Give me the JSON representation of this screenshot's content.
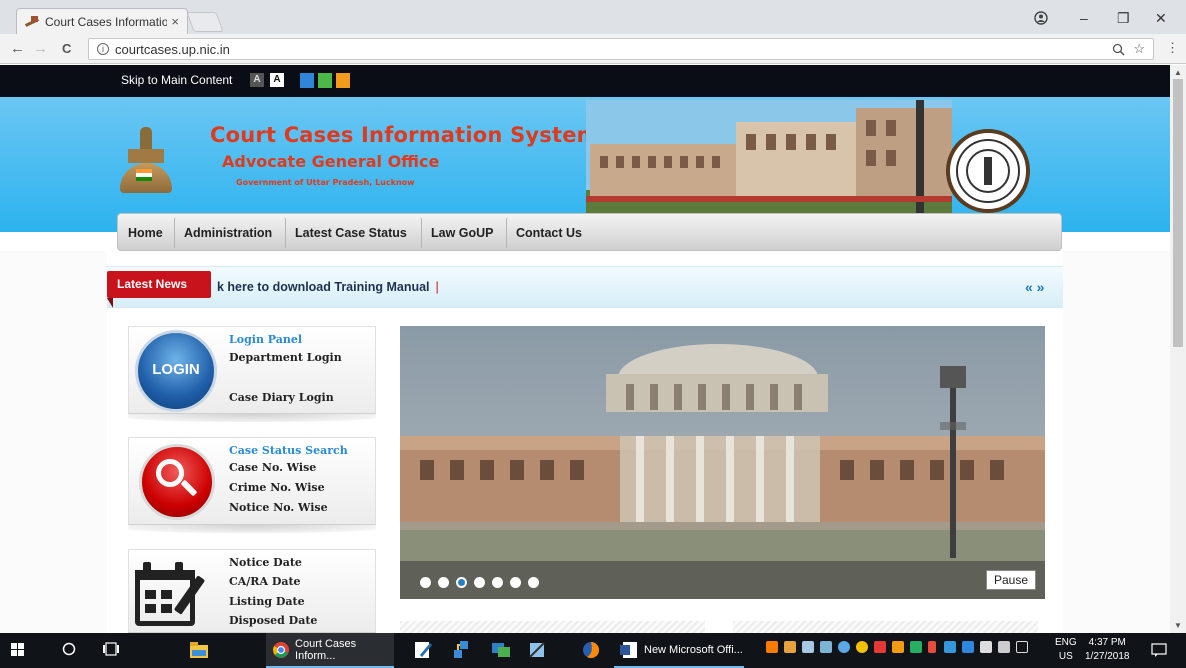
{
  "browser": {
    "tab_title": "Court Cases Information",
    "tab_close": "×",
    "url": "courtcases.up.nic.in",
    "info_glyph": "i",
    "window_controls": {
      "minimize": "–",
      "restore": "❐",
      "close": "✕"
    },
    "nav": {
      "back": "←",
      "forward": "→",
      "reload": "C"
    }
  },
  "accessibility": {
    "skip_link": "Skip to Main Content",
    "font_btn_1": "A",
    "font_btn_2": "A",
    "themes": [
      "#2f86d6",
      "#4cb848",
      "#f29a1c"
    ]
  },
  "header": {
    "title": "Court Cases Information System",
    "subtitle": "Advocate General Office",
    "gov_line": "Government of Uttar Pradesh, Lucknow"
  },
  "menu": {
    "items": [
      "Home",
      "Administration",
      "Latest Case Status",
      "Law GoUP",
      "Contact Us"
    ]
  },
  "news": {
    "label": "Latest News",
    "text": "k here to download Training Manual",
    "separator": "|",
    "nav": "« »"
  },
  "panels": {
    "login": {
      "icon_text": "LOGIN",
      "title": "Login Panel",
      "links": [
        "Department Login",
        "Case Diary Login"
      ]
    },
    "search": {
      "title": "Case Status Search",
      "links": [
        "Case No. Wise",
        "Crime No. Wise",
        "Notice No. Wise"
      ]
    },
    "dates": {
      "links": [
        "Notice Date",
        "CA/RA Date",
        "Listing Date",
        "Disposed Date"
      ]
    }
  },
  "slider": {
    "pause_label": "Pause",
    "dot_count": 7,
    "active_dot": 3
  },
  "taskbar": {
    "apps": [
      "Court Cases Inform...",
      "New Microsoft Offi..."
    ],
    "lang": "ENG",
    "region": "US",
    "time": "4:37 PM",
    "date": "1/27/2018"
  }
}
